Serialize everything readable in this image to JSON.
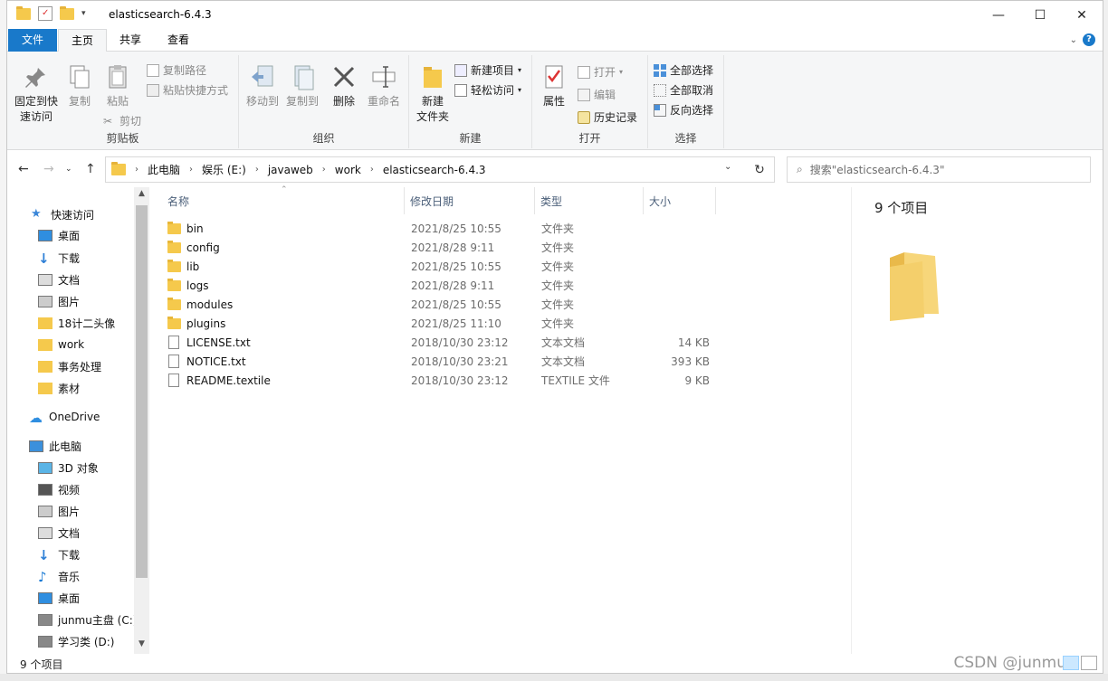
{
  "window": {
    "title": "elasticsearch-6.4.3"
  },
  "tabs": [
    "文件",
    "主页",
    "共享",
    "查看"
  ],
  "ribbon": {
    "clipboard": {
      "pin": "固定到快\n速访问",
      "copy": "复制",
      "paste": "粘贴",
      "copy_path": "复制路径",
      "paste_shortcut": "粘贴快捷方式",
      "cut": "剪切",
      "label": "剪贴板"
    },
    "organize": {
      "move_to": "移动到",
      "copy_to": "复制到",
      "delete": "删除",
      "rename": "重命名",
      "label": "组织"
    },
    "new": {
      "new_folder": "新建\n文件夹",
      "new_item": "新建项目",
      "easy_access": "轻松访问",
      "label": "新建"
    },
    "open": {
      "properties": "属性",
      "open": "打开",
      "edit": "编辑",
      "history": "历史记录",
      "label": "打开"
    },
    "select": {
      "select_all": "全部选择",
      "select_none": "全部取消",
      "invert": "反向选择",
      "label": "选择"
    }
  },
  "address": {
    "crumbs": [
      "此电脑",
      "娱乐 (E:)",
      "javaweb",
      "work",
      "elasticsearch-6.4.3"
    ]
  },
  "search": {
    "placeholder": "搜索\"elasticsearch-6.4.3\""
  },
  "nav": {
    "items": [
      {
        "label": "快速访问",
        "icon": "star-icon",
        "pinned": false
      },
      {
        "label": "桌面",
        "icon": "desktop-icon",
        "pinned": true
      },
      {
        "label": "下载",
        "icon": "download-icon",
        "pinned": true
      },
      {
        "label": "文档",
        "icon": "document-icon",
        "pinned": true
      },
      {
        "label": "图片",
        "icon": "picture-icon",
        "pinned": true
      },
      {
        "label": "18计二头像",
        "icon": "folder-icon",
        "pinned": false
      },
      {
        "label": "work",
        "icon": "folder-icon",
        "pinned": false
      },
      {
        "label": "事务处理",
        "icon": "folder-icon",
        "pinned": false
      },
      {
        "label": "素材",
        "icon": "folder-icon",
        "pinned": false
      },
      {
        "label": "OneDrive",
        "icon": "cloud-icon",
        "pinned": false
      },
      {
        "label": "此电脑",
        "icon": "computer-icon",
        "pinned": false
      },
      {
        "label": "3D 对象",
        "icon": "cube-icon",
        "pinned": false
      },
      {
        "label": "视频",
        "icon": "video-icon",
        "pinned": false
      },
      {
        "label": "图片",
        "icon": "picture-icon",
        "pinned": false
      },
      {
        "label": "文档",
        "icon": "document-icon",
        "pinned": false
      },
      {
        "label": "下载",
        "icon": "download-icon",
        "pinned": false
      },
      {
        "label": "音乐",
        "icon": "music-icon",
        "pinned": false
      },
      {
        "label": "桌面",
        "icon": "desktop-icon",
        "pinned": false
      },
      {
        "label": "junmu主盘 (C:)",
        "icon": "drive-icon",
        "pinned": false
      },
      {
        "label": "学习类 (D:)",
        "icon": "drive-icon",
        "pinned": false
      }
    ]
  },
  "columns": {
    "name": "名称",
    "date": "修改日期",
    "type": "类型",
    "size": "大小"
  },
  "files": [
    {
      "name": "bin",
      "date": "2021/8/25 10:55",
      "type": "文件夹",
      "size": "",
      "kind": "folder"
    },
    {
      "name": "config",
      "date": "2021/8/28 9:11",
      "type": "文件夹",
      "size": "",
      "kind": "folder"
    },
    {
      "name": "lib",
      "date": "2021/8/25 10:55",
      "type": "文件夹",
      "size": "",
      "kind": "folder"
    },
    {
      "name": "logs",
      "date": "2021/8/28 9:11",
      "type": "文件夹",
      "size": "",
      "kind": "folder"
    },
    {
      "name": "modules",
      "date": "2021/8/25 10:55",
      "type": "文件夹",
      "size": "",
      "kind": "folder"
    },
    {
      "name": "plugins",
      "date": "2021/8/25 11:10",
      "type": "文件夹",
      "size": "",
      "kind": "folder"
    },
    {
      "name": "LICENSE.txt",
      "date": "2018/10/30 23:12",
      "type": "文本文档",
      "size": "14 KB",
      "kind": "doc"
    },
    {
      "name": "NOTICE.txt",
      "date": "2018/10/30 23:21",
      "type": "文本文档",
      "size": "393 KB",
      "kind": "doc"
    },
    {
      "name": "README.textile",
      "date": "2018/10/30 23:12",
      "type": "TEXTILE 文件",
      "size": "9 KB",
      "kind": "doc"
    }
  ],
  "preview": {
    "count": "9 个项目"
  },
  "status": {
    "count": "9 个项目"
  },
  "watermark": "CSDN @junmu"
}
